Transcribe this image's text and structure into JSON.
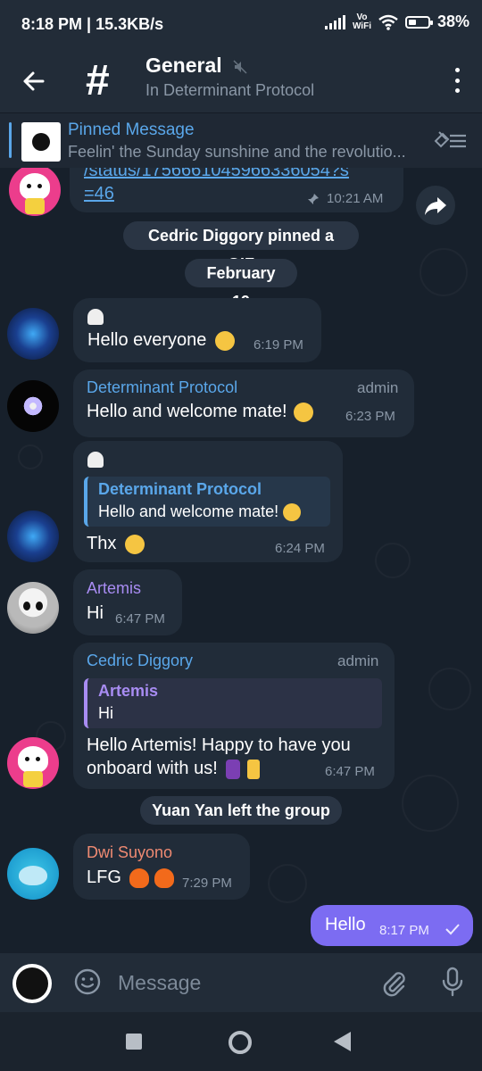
{
  "status": {
    "time_speed": "8:18 PM | 15.3KB/s",
    "vowifi_top": "Vo",
    "vowifi_bottom": "WiFi",
    "battery": "38%",
    "battery_level": 0.38
  },
  "header": {
    "title": "General",
    "subtitle": "In Determinant Protocol",
    "icon": "#"
  },
  "pinned": {
    "label": "Pinned Message",
    "text": "Feelin' the Sunday sunshine and the revolutio..."
  },
  "messages": {
    "m0": {
      "link1": "/status/1756661045966336054?s",
      "link2": "=46",
      "time": "10:21 AM"
    },
    "svc_pinned": "Cedric Diggory pinned a GIF",
    "date": "February 19",
    "m1": {
      "text": "Hello everyone",
      "time": "6:19 PM"
    },
    "m2": {
      "sender": "Determinant Protocol",
      "role": "admin",
      "text": "Hello and welcome mate!",
      "time": "6:23 PM"
    },
    "m3": {
      "reply_name": "Determinant Protocol",
      "reply_text": "Hello and welcome mate!",
      "text": "Thx",
      "time": "6:24 PM"
    },
    "m4": {
      "sender": "Artemis",
      "text": "Hi",
      "time": "6:47 PM"
    },
    "m5": {
      "sender": "Cedric Diggory",
      "role": "admin",
      "reply_name": "Artemis",
      "reply_text": "Hi",
      "line1": "Hello Artemis! Happy to have you",
      "line2": "onboard with us!",
      "time": "6:47 PM"
    },
    "svc_left": "Yuan Yan left the group",
    "m6": {
      "sender": "Dwi Suyono",
      "text": "LFG",
      "time": "7:29 PM"
    },
    "m7": {
      "text": "Hello",
      "time": "8:17 PM"
    }
  },
  "input": {
    "placeholder": "Message"
  },
  "colors": {
    "accent_blue": "#5aa7ea",
    "artemis_purple": "#a88cf2",
    "dwi_orange": "#ef8a72",
    "outgoing_bubble": "#7c6cf2"
  }
}
